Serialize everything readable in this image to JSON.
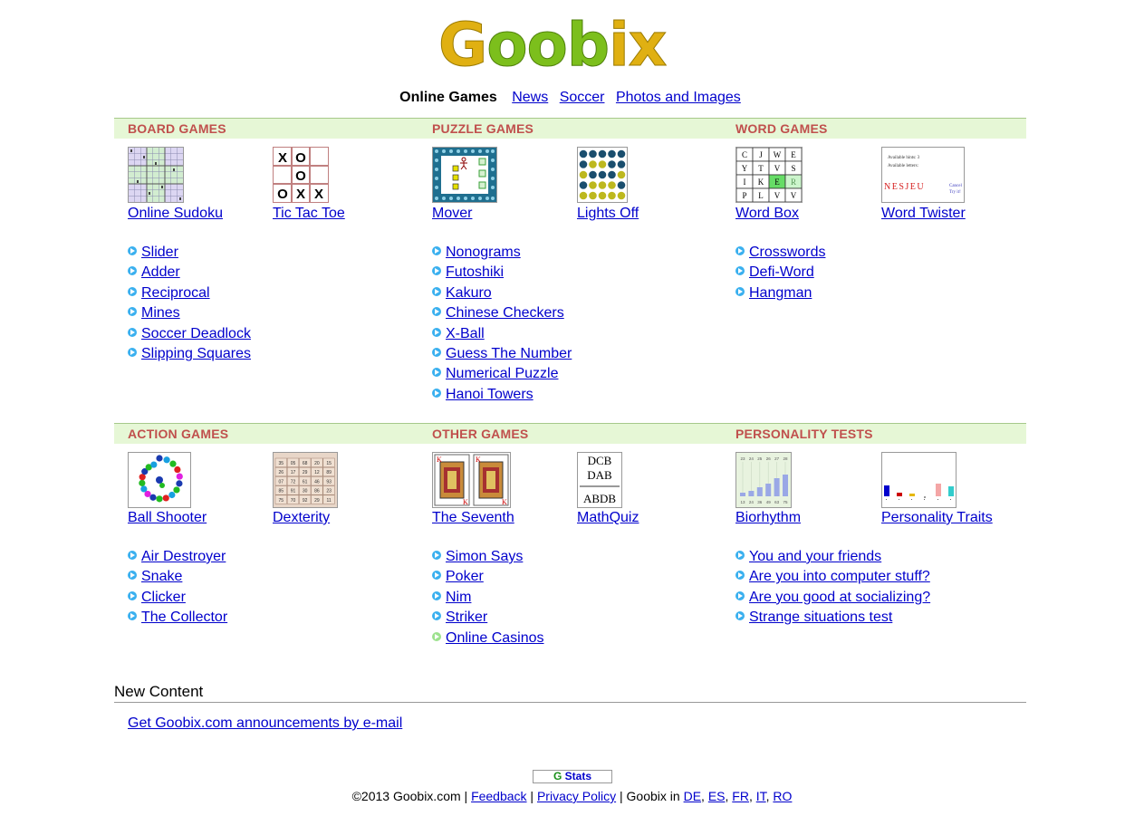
{
  "logo": {
    "text": "Goobix",
    "letters": [
      "G",
      "oo",
      "b",
      "i",
      "x"
    ]
  },
  "nav": {
    "current": "Online Games",
    "links": [
      "News",
      "Soccer",
      "Photos and Images"
    ]
  },
  "sections": [
    {
      "title": "BOARD GAMES",
      "featured": [
        {
          "label": "Online Sudoku",
          "icon": "sudoku-icon"
        },
        {
          "label": "Tic Tac Toe",
          "icon": "tictactoe-icon"
        }
      ],
      "items": [
        "Slider",
        "Adder",
        "Reciprocal",
        "Mines",
        "Soccer Deadlock",
        "Slipping Squares"
      ]
    },
    {
      "title": "PUZZLE GAMES",
      "featured": [
        {
          "label": "Mover",
          "icon": "mover-icon"
        },
        {
          "label": "Lights Off",
          "icon": "lights-off-icon"
        }
      ],
      "items": [
        "Nonograms",
        "Futoshiki",
        "Kakuro",
        "Chinese Checkers",
        "X-Ball",
        "Guess The Number",
        "Numerical Puzzle",
        "Hanoi Towers"
      ]
    },
    {
      "title": "WORD GAMES",
      "featured": [
        {
          "label": "Word Box",
          "icon": "word-box-icon"
        },
        {
          "label": "Word Twister",
          "icon": "word-twister-icon"
        }
      ],
      "items": [
        "Crosswords",
        "Defi-Word",
        "Hangman"
      ]
    },
    {
      "title": "ACTION GAMES",
      "featured": [
        {
          "label": "Ball Shooter",
          "icon": "ball-shooter-icon"
        },
        {
          "label": "Dexterity",
          "icon": "dexterity-icon"
        }
      ],
      "items": [
        "Air Destroyer",
        "Snake",
        "Clicker",
        "The Collector"
      ]
    },
    {
      "title": "OTHER GAMES",
      "featured": [
        {
          "label": "The Seventh",
          "icon": "cards-icon"
        },
        {
          "label": "MathQuiz",
          "icon": "mathquiz-icon"
        }
      ],
      "items": [
        "Simon Says",
        "Poker",
        "Nim",
        "Striker",
        "Online Casinos"
      ]
    },
    {
      "title": "PERSONALITY TESTS",
      "featured": [
        {
          "label": "Biorhythm",
          "icon": "biorhythm-icon"
        },
        {
          "label": "Personality Traits",
          "icon": "personality-traits-icon"
        }
      ],
      "items": [
        "You and your friends",
        "Are you into computer stuff?",
        "Are you good at socializing?",
        "Strange situations test"
      ]
    }
  ],
  "thumb_text": {
    "tictactoe": [
      "X",
      "O",
      "",
      "",
      "O",
      "",
      "O",
      "X",
      "X"
    ],
    "wordbox": [
      "C",
      "J",
      "W",
      "E",
      "Y",
      "T",
      "V",
      "S",
      "I",
      "K",
      "E",
      "R",
      "P",
      "L",
      "V",
      "V"
    ],
    "wordtwister": {
      "line1": "Available hints: 3",
      "line2": "Available letters:",
      "word": "NESJEU",
      "cancel": "Cancel",
      "try": "Try it!"
    },
    "mathquiz": [
      "DCB",
      "DAB",
      "ABDB"
    ],
    "dexterity": [
      "35",
      "05",
      "68",
      "20",
      "15",
      "26",
      "17",
      "29",
      "12",
      "89",
      "07",
      "72",
      "61",
      "46",
      "93",
      "85",
      "91",
      "30",
      "86",
      "23",
      "75",
      "70",
      "92",
      "29",
      "11"
    ],
    "biorhythm_top": [
      "23",
      "24",
      "25",
      "26",
      "27",
      "28"
    ],
    "biorhythm_bottom": [
      "13",
      "24",
      "36",
      "49",
      "63",
      "75"
    ],
    "seventh_rank": "K"
  },
  "new_content": {
    "heading": "New Content",
    "email_link": "Get Goobix.com announcements by e-mail"
  },
  "stats": {
    "g": "G",
    "label": "Stats"
  },
  "footer": {
    "copyright": "©2013 Goobix.com",
    "feedback": "Feedback",
    "privacy": "Privacy Policy",
    "goobix_in": "Goobix in",
    "languages": [
      "DE",
      "ES",
      "FR",
      "IT",
      "RO"
    ]
  },
  "colors": {
    "section_title": "#c0504d",
    "band": "#e6f7d6",
    "link": "#0000cc",
    "bullet": "#3ab0ef",
    "bullet_alt": "#9de28e"
  }
}
